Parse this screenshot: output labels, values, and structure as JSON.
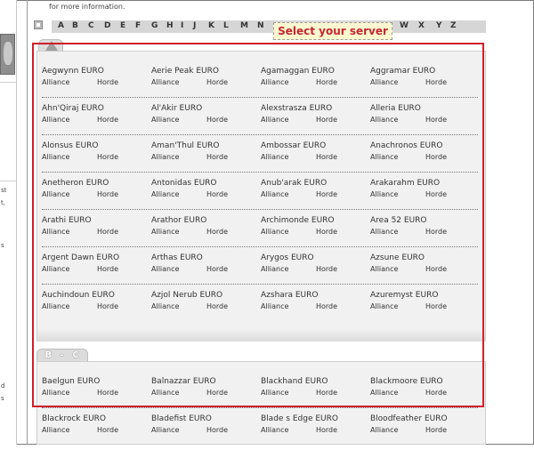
{
  "intro_text": "for more information.",
  "alphabet": [
    "A",
    "B",
    "C",
    "D",
    "E",
    "F",
    "G",
    "H",
    "I",
    "J",
    "K",
    "L",
    "M",
    "N",
    "W",
    "X",
    "Y",
    "Z"
  ],
  "tooltip": "Select your server",
  "left_snippets": [
    "st",
    "t,",
    "s",
    "d",
    "s"
  ],
  "tabs": {
    "bc_label": "B - C"
  },
  "faction": {
    "alliance": "Alliance",
    "horde": "Horde"
  },
  "realms_a": [
    [
      "Aegwynn EURO",
      "Aerie Peak EURO",
      "Agamaggan EURO",
      "Aggramar EURO"
    ],
    [
      "Ahn'Qiraj EURO",
      "Al'Akir EURO",
      "Alexstrasza EURO",
      "Alleria EURO"
    ],
    [
      "Alonsus EURO",
      "Aman'Thul EURO",
      "Ambossar EURO",
      "Anachronos EURO"
    ],
    [
      "Anetheron EURO",
      "Antonidas EURO",
      "Anub'arak EURO",
      "Arakarahm EURO"
    ],
    [
      "Arathi EURO",
      "Arathor EURO",
      "Archimonde EURO",
      "Area 52 EURO"
    ],
    [
      "Argent Dawn EURO",
      "Arthas EURO",
      "Arygos EURO",
      "Azsune EURO"
    ],
    [
      "Auchindoun EURO",
      "Azjol Nerub EURO",
      "Azshara EURO",
      "Azuremyst EURO"
    ]
  ],
  "realms_bc": [
    [
      "Baelgun EURO",
      "Balnazzar EURO",
      "Blackhand EURO",
      "Blackmoore EURO"
    ],
    [
      "Blackrock EURO",
      "Bladefist EURO",
      "Blade s Edge EURO",
      "Bloodfeather EURO"
    ]
  ]
}
